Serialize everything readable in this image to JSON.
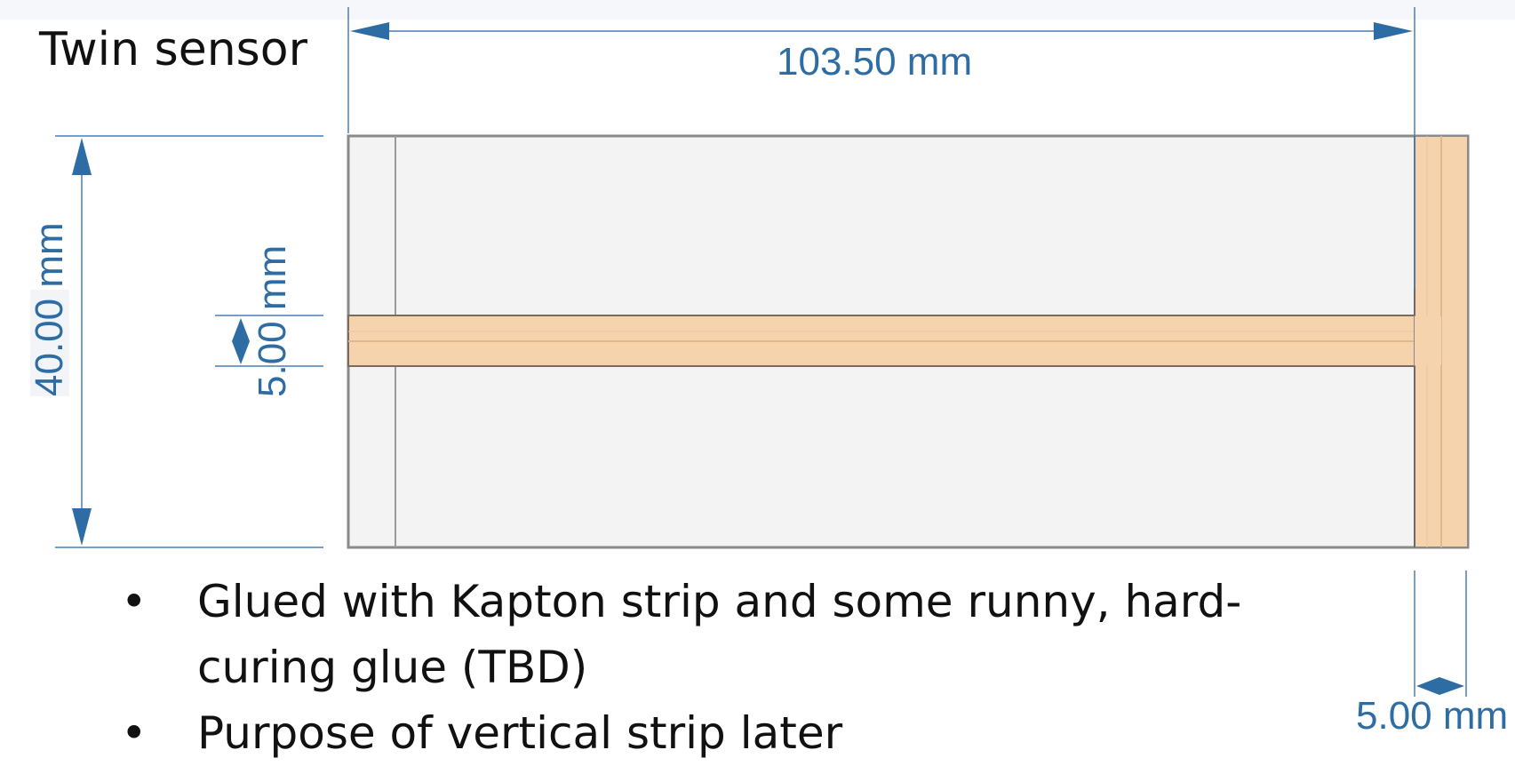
{
  "title": "Twin sensor",
  "dimensions": {
    "total_length": "103.50 mm",
    "height": "40.00 mm",
    "horizontal_strip_width": "5.00 mm",
    "vertical_strip_width": "5.00 mm"
  },
  "bullets": [
    {
      "marker": "•",
      "text": "Glued with Kapton strip and some runny, hard-curing glue (TBD)"
    },
    {
      "marker": "•",
      "text": "Purpose of vertical strip later"
    }
  ],
  "colors": {
    "dimension": "#2e6da4",
    "sensor_fill": "#f3f3f3",
    "sensor_outline": "#8a8a8a",
    "kapton_strip": "#f5d3ad",
    "kapton_outline": "#e2b78b"
  }
}
